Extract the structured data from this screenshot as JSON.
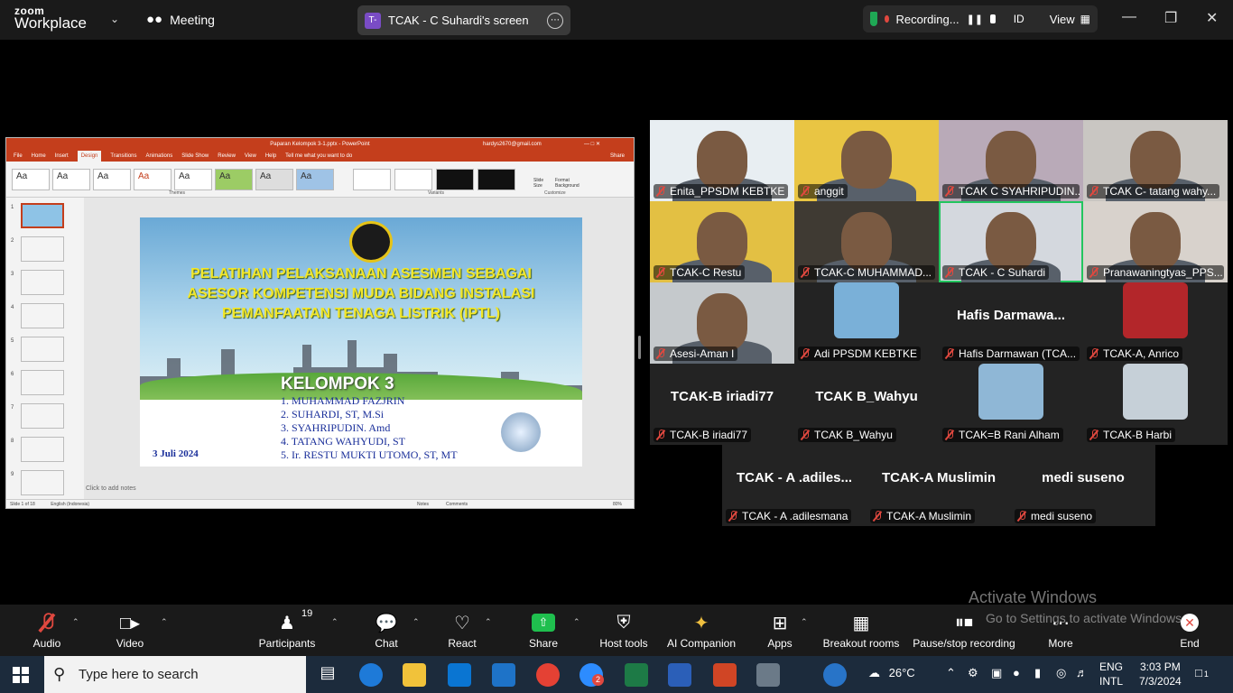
{
  "app": {
    "brand_top": "zoom",
    "brand_bottom": "Workplace",
    "meeting_label": "Meeting"
  },
  "share": {
    "badge": "T-",
    "title": "TCAK - C Suhardi's screen"
  },
  "recording": {
    "label": "Recording...",
    "id_label": "ID",
    "view_label": "View"
  },
  "ppt": {
    "window_title": "Paparan Kelompok 3-1.pptx - PowerPoint",
    "account": "hardys2670@gmail.com",
    "menus": [
      "File",
      "Home",
      "Insert",
      "Design",
      "Transitions",
      "Animations",
      "Slide Show",
      "Review",
      "View",
      "Help",
      "Tell me what you want to do"
    ],
    "active_menu": "Design",
    "share_label": "Share",
    "themes_label": "Themes",
    "variants_label": "Variants",
    "customize_label": "Customize",
    "slide_size_label": "Slide Size",
    "format_bg_label": "Format Background",
    "theme_sample": "Aa",
    "thumbnails": [
      "1",
      "2",
      "3",
      "4",
      "5",
      "6",
      "7",
      "8",
      "9"
    ],
    "slide": {
      "title_line1": "PELATIHAN PELAKSANAAN ASESMEN SEBAGAI",
      "title_line2": "ASESOR KOMPETENSI MUDA BIDANG INSTALASI",
      "title_line3": "PEMANFAATAN TENAGA LISTRIK (IPTL)",
      "group": "KELOMPOK 3",
      "members": [
        "1. MUHAMMAD FAZJRIN",
        "2. SUHARDI, ST, M.Si",
        "3. SYAHRIPUDIN. Amd",
        "4. TATANG WAHYUDI, ST",
        "5. Ir. RESTU MUKTI UTOMO, ST, MT"
      ],
      "date": "3 Juli 2024"
    },
    "notes_placeholder": "Click to add notes",
    "status": {
      "slide": "Slide 1 of 18",
      "language": "English (Indonesia)",
      "notes": "Notes",
      "comments": "Comments",
      "zoom": "80%"
    }
  },
  "participants_gallery": [
    {
      "name": "Enita_PPSDM KEBTKE",
      "type": "photo"
    },
    {
      "name": "anggit",
      "type": "photo"
    },
    {
      "name": "TCAK C SYAHRIPUDIN...",
      "type": "photo"
    },
    {
      "name": "TCAK C- tatang wahy...",
      "type": "photo"
    },
    {
      "name": "TCAK-C Restu",
      "type": "photo"
    },
    {
      "name": "TCAK-C MUHAMMAD...",
      "type": "photo"
    },
    {
      "name": "TCAK - C Suhardi",
      "type": "photo",
      "active": true
    },
    {
      "name": "Pranawaningtyas_PPS...",
      "type": "photo"
    },
    {
      "name": "Asesi-Aman I",
      "type": "photo"
    },
    {
      "name": "Adi PPSDM KEBTKE",
      "type": "avatar"
    },
    {
      "name": "Hafis Darmawan (TCA...",
      "type": "text",
      "big": "Hafis  Darmawa..."
    },
    {
      "name": "TCAK-A, Anrico",
      "type": "avatar"
    },
    {
      "name": "TCAK-B iriadi77",
      "type": "text",
      "big": "TCAK-B iriadi77"
    },
    {
      "name": "TCAK B_Wahyu",
      "type": "text",
      "big": "TCAK B_Wahyu"
    },
    {
      "name": "TCAK=B Rani Alham",
      "type": "avatar"
    },
    {
      "name": "TCAK-B Harbi",
      "type": "avatar"
    },
    {
      "name": "TCAK - A .adilesmana",
      "type": "text",
      "big": "TCAK - A .adiles..."
    },
    {
      "name": "TCAK-A Muslimin",
      "type": "text",
      "big": "TCAK-A Muslimin"
    },
    {
      "name": "medi suseno",
      "type": "text",
      "big": "medi suseno"
    }
  ],
  "toolbar": {
    "audio": "Audio",
    "video": "Video",
    "participants": "Participants",
    "participants_count": "19",
    "chat": "Chat",
    "react": "React",
    "share": "Share",
    "host_tools": "Host tools",
    "ai_companion": "AI Companion",
    "apps": "Apps",
    "breakout": "Breakout rooms",
    "pause_recording": "Pause/stop recording",
    "more": "More",
    "end": "End"
  },
  "watermark": {
    "line1": "Activate Windows",
    "line2": "Go to Settings to activate Windows."
  },
  "taskbar": {
    "search_placeholder": "Type here to search",
    "zoom_badge": "2",
    "weather": "26°C",
    "lang_top": "ENG",
    "lang_bottom": "INTL",
    "time": "3:03 PM",
    "date": "7/3/2024",
    "notif_count": "1"
  },
  "colors": {
    "accent_green": "#22c55e",
    "record_red": "#e0483f",
    "ppt_red": "#c43e1c",
    "taskbar": "#1c2b3c"
  }
}
